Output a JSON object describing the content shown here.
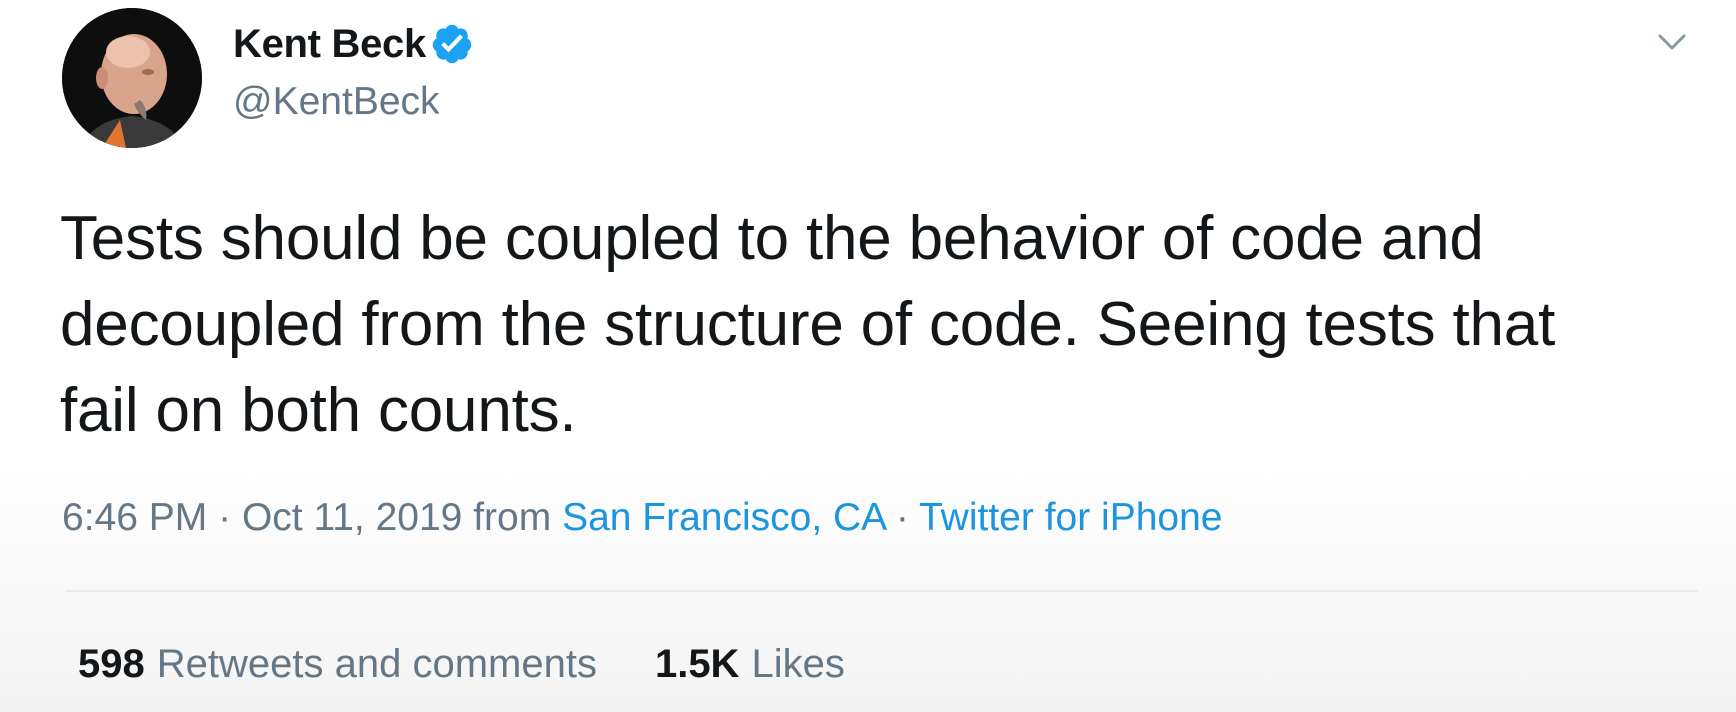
{
  "author": {
    "display_name": "Kent Beck",
    "handle": "@KentBeck",
    "verified": true
  },
  "tweet": {
    "text": "Tests should be coupled to the behavior of code and decoupled from the structure of code. Seeing tests that fail on both counts.",
    "time": "6:46 PM",
    "separator": "·",
    "date": "Oct 11, 2019",
    "from_label": "from",
    "location": "San Francisco, CA",
    "source": "Twitter for iPhone"
  },
  "stats": {
    "retweets_count": "598",
    "retweets_label": "Retweets and comments",
    "likes_count": "1.5K",
    "likes_label": "Likes"
  },
  "colors": {
    "text_primary": "#14171a",
    "text_secondary": "#657786",
    "link": "#1b95e0",
    "verified_badge": "#1da1f2",
    "divider": "#e6ecf0"
  },
  "icons": {
    "verified": "verified-badge-icon",
    "caret": "chevron-down-icon"
  }
}
